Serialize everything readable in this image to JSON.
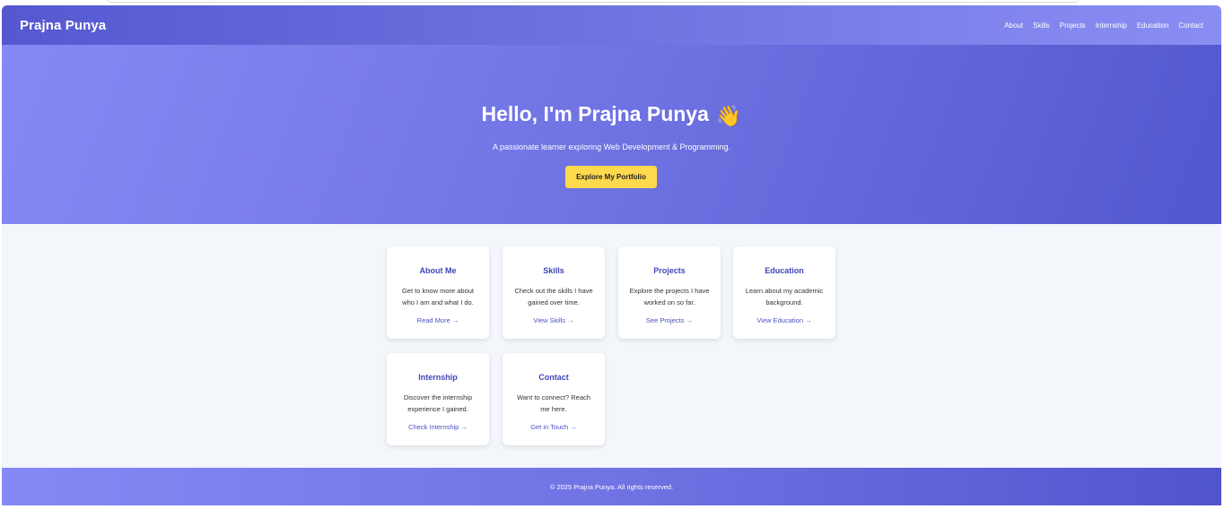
{
  "nav": {
    "brand": "Prajna Punya",
    "links": [
      "About",
      "Skills",
      "Projects",
      "Internship",
      "Education",
      "Contact"
    ]
  },
  "hero": {
    "title": "Hello, I'm Prajna Punya",
    "emoji": "👋",
    "subtitle": "A passionate learner exploring Web Development & Programming.",
    "cta": "Explore My Portfolio"
  },
  "cards": [
    {
      "title": "About Me",
      "desc": "Get to know more about who I am and what I do.",
      "link": "Read More →"
    },
    {
      "title": "Skills",
      "desc": "Check out the skills I have gained over time.",
      "link": "View Skills →"
    },
    {
      "title": "Projects",
      "desc": "Explore the projects I have worked on so far.",
      "link": "See Projects →"
    },
    {
      "title": "Education",
      "desc": "Learn about my academic background.",
      "link": "View Education →"
    },
    {
      "title": "Internship",
      "desc": "Discover the internship experience I gained.",
      "link": "Check Internship →"
    },
    {
      "title": "Contact",
      "desc": "Want to connect? Reach me here.",
      "link": "Get in Touch →"
    }
  ],
  "footer": {
    "text": "© 2025 Prajna Punya. All rights reserved."
  },
  "colors": {
    "accent": "#5a5fd6",
    "cta": "#fdd94e",
    "card_title": "#3e46b8"
  }
}
